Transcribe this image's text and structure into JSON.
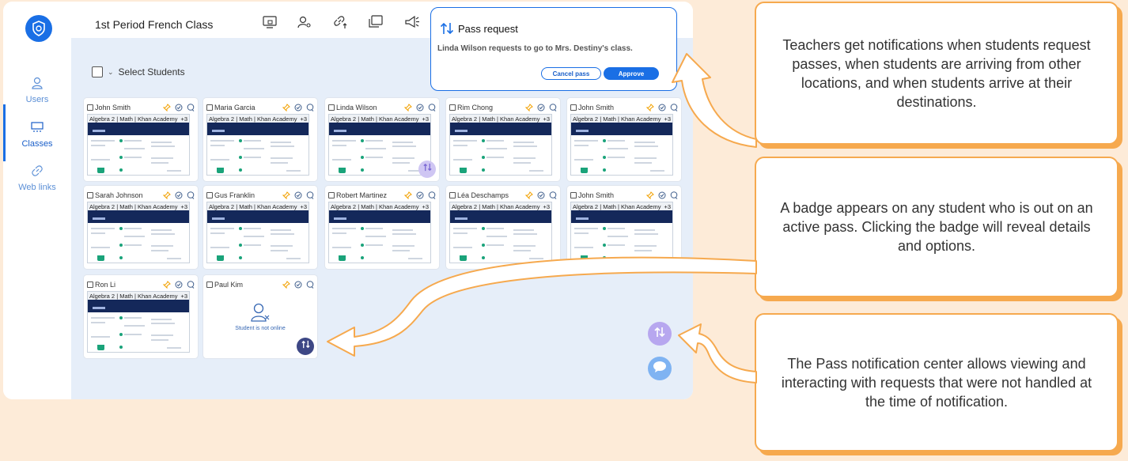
{
  "sidebar": {
    "items": [
      {
        "label": "Users",
        "icon": "user-icon"
      },
      {
        "label": "Classes",
        "icon": "classes-icon"
      },
      {
        "label": "Web links",
        "icon": "link-icon"
      }
    ]
  },
  "header": {
    "class_name": "1st Period French Class",
    "icons": [
      "lock-screen-icon",
      "user-key-icon",
      "link-share-icon",
      "window-icon",
      "megaphone-icon"
    ]
  },
  "toolbar": {
    "select_students_label": "Select Students"
  },
  "students": [
    {
      "name": "John Smith",
      "tab": "Algebra 2 | Math | Khan Academy",
      "tab_count": "+3",
      "online": true
    },
    {
      "name": "Maria Garcia",
      "tab": "Algebra 2 | Math | Khan Academy",
      "tab_count": "+3",
      "online": true
    },
    {
      "name": "Linda Wilson",
      "tab": "Algebra 2 | Math | Khan Academy",
      "tab_count": "+3",
      "online": true,
      "pass_badge": true
    },
    {
      "name": "Rim Chong",
      "tab": "Algebra 2 | Math | Khan Academy",
      "tab_count": "+3",
      "online": true
    },
    {
      "name": "John Smith",
      "tab": "Algebra 2 | Math | Khan Academy",
      "tab_count": "+3",
      "online": true
    },
    {
      "name": "Sarah Johnson",
      "tab": "Algebra 2 | Math | Khan Academy",
      "tab_count": "+3",
      "online": true
    },
    {
      "name": "Gus Franklin",
      "tab": "Algebra 2 | Math | Khan Academy",
      "tab_count": "+3",
      "online": true
    },
    {
      "name": "Robert Martinez",
      "tab": "Algebra 2 | Math | Khan Academy",
      "tab_count": "+3",
      "online": true
    },
    {
      "name": "Léa Deschamps",
      "tab": "Algebra 2 | Math | Khan Academy",
      "tab_count": "+3",
      "online": true
    },
    {
      "name": "John Smith",
      "tab": "Algebra 2 | Math | Khan Academy",
      "tab_count": "+3",
      "online": true
    },
    {
      "name": "Ron Li",
      "tab": "Algebra 2 | Math | Khan Academy",
      "tab_count": "+3",
      "online": true
    },
    {
      "name": "Paul Kim",
      "online": false,
      "offline_text": "Student is not online",
      "pass_badge": true
    }
  ],
  "popup": {
    "title": "Pass request",
    "message": "Linda Wilson requests to go to Mrs. Destiny's class.",
    "cancel_label": "Cancel pass",
    "approve_label": "Approve"
  },
  "callouts": [
    {
      "text": "Teachers get notifications when students request passes, when students are arriving from other locations, and when students arrive at their destinations."
    },
    {
      "text": "A badge appears on any student who is out on an active pass. Clicking the badge will reveal details and options."
    },
    {
      "text": "The Pass notification center allows viewing and interacting with requests that were not handled at the time of notification."
    }
  ],
  "colors": {
    "accent": "#1a6fe5",
    "callout_border": "#f6a94e",
    "page_background": "#fdebd8",
    "badge_purple": "#b7a7ef",
    "badge_dark": "#3d4785",
    "chat_blue": "#7fb3f2"
  }
}
